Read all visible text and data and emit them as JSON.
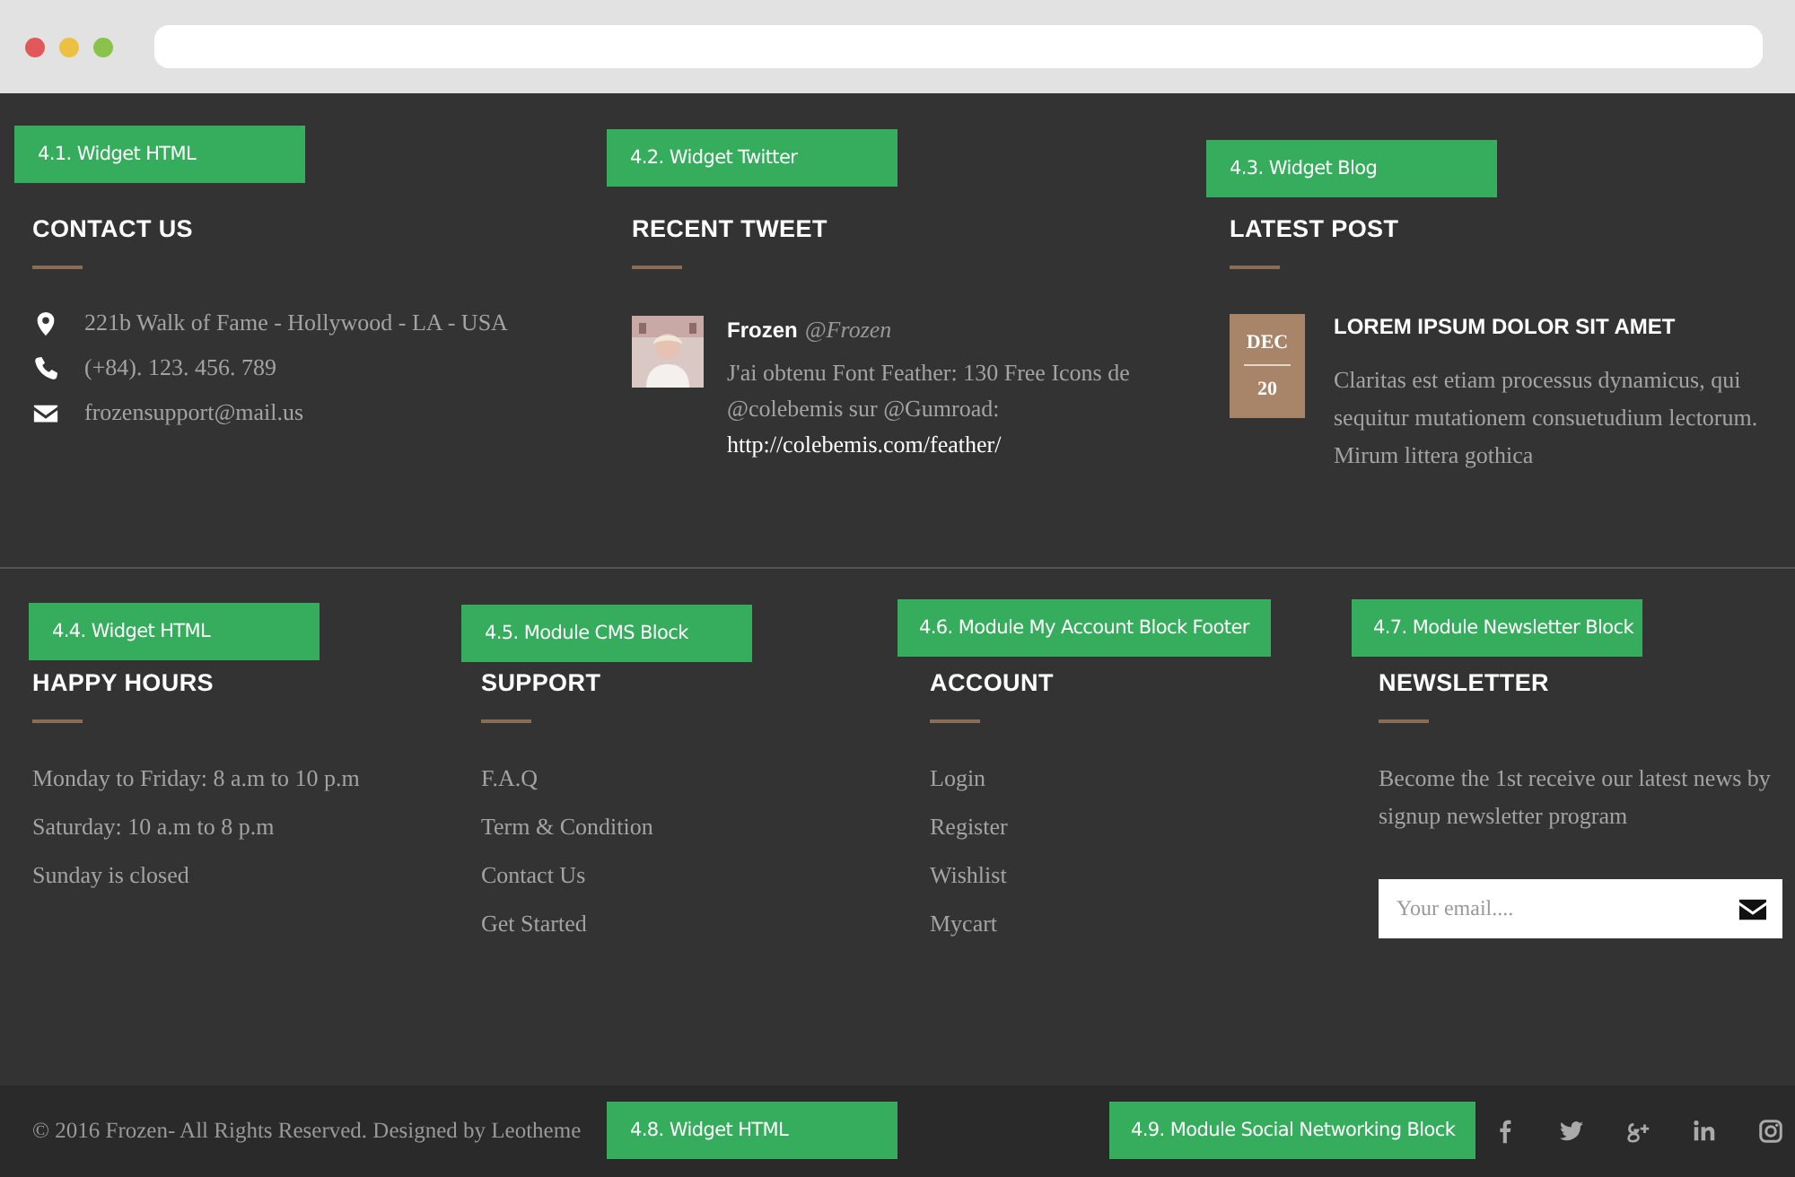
{
  "window_controls": [
    {
      "color": "#e0585a"
    },
    {
      "color": "#ecc042"
    },
    {
      "color": "#8bc34a"
    }
  ],
  "annotations": [
    {
      "label": "4.1. Widget HTML"
    },
    {
      "label": "4.2. Widget Twitter"
    },
    {
      "label": "4.3. Widget Blog"
    },
    {
      "label": "4.4. Widget HTML"
    },
    {
      "label": "4.5. Module CMS Block"
    },
    {
      "label": "4.6. Module My Account Block Footer"
    },
    {
      "label": "4.7. Module Newsletter Block"
    },
    {
      "label": "4.8. Widget HTML"
    },
    {
      "label": "4.9. Module Social Networking Block"
    }
  ],
  "contact": {
    "title": "CONTACT US",
    "items": [
      {
        "kind": "location",
        "text": "221b Walk of Fame - Hollywood - LA - USA"
      },
      {
        "kind": "phone",
        "text": "(+84). 123. 456. 789"
      },
      {
        "kind": "email",
        "text": "frozensupport@mail.us"
      }
    ]
  },
  "tweet": {
    "title": "RECENT TWEET",
    "author": "Frozen",
    "handle": "@Frozen",
    "text": "J'ai obtenu Font Feather: 130 Free Icons de @colebemis sur @Gumroad:",
    "link": "http://colebemis.com/feather/"
  },
  "latest_post": {
    "title": "LATEST POST",
    "month": "DEC",
    "day": "20",
    "post_title": "LOREM IPSUM DOLOR SIT AMET",
    "excerpt": "Claritas est etiam processus dynamicus, qui sequitur mutationem consuetudium lectorum. Mirum littera gothica"
  },
  "happy_hours": {
    "title": "HAPPY HOURS",
    "lines": [
      "Monday to Friday: 8 a.m to 10 p.m",
      "Saturday: 10 a.m to 8 p.m",
      "Sunday is closed"
    ]
  },
  "support": {
    "title": "SUPPORT",
    "links": [
      "F.A.Q",
      "Term & Condition",
      "Contact Us",
      "Get Started"
    ]
  },
  "account": {
    "title": "ACCOUNT",
    "links": [
      "Login",
      "Register",
      "Wishlist",
      "Mycart"
    ]
  },
  "newsletter": {
    "title": "NEWSLETTER",
    "text": "Become the 1st receive our latest news by signup newsletter program",
    "placeholder": "Your email...."
  },
  "footer": {
    "copyright": "© 2016 Frozen- All Rights Reserved. Designed by Leotheme",
    "social": [
      {
        "kind": "facebook"
      },
      {
        "kind": "twitter"
      },
      {
        "kind": "google-plus"
      },
      {
        "kind": "linkedin"
      },
      {
        "kind": "instagram"
      }
    ]
  }
}
